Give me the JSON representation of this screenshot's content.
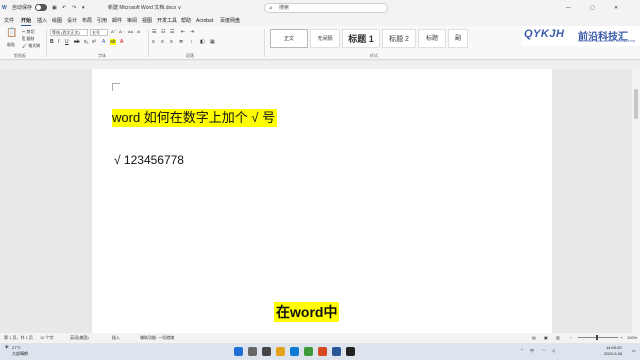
{
  "titlebar": {
    "autosave_label": "自动保存",
    "doc_title": "新建 Microsoft Word 文档.docx ∨",
    "search_placeholder": "搜索"
  },
  "menu": {
    "items": [
      "文件",
      "开始",
      "插入",
      "绘图",
      "设计",
      "布局",
      "引用",
      "邮件",
      "审阅",
      "视图",
      "开发工具",
      "帮助",
      "Acrobat",
      "百度网盘"
    ],
    "active": "开始"
  },
  "ribbon": {
    "paste_label": "粘贴",
    "cut_label": "剪切",
    "copy_label": "复制",
    "format_painter_label": "格式刷",
    "font_name": "等线 (西文正文)",
    "font_size": "五号",
    "styles": [
      "正文",
      "无间隔",
      "标题 1",
      "标题 2",
      "标题",
      "副"
    ],
    "group_labels": {
      "clipboard": "剪贴板",
      "font": "字体",
      "paragraph": "段落",
      "styles": "样式"
    }
  },
  "logo": {
    "mark": "QYKJH",
    "name": "前沿科技汇",
    "sub": "FRONTIER TECHNOLOGY COLLECTION"
  },
  "document": {
    "heading_text": "word 如何在数字上加个 √ 号",
    "number_line": "√ 123456778"
  },
  "subtitle": "在word中",
  "statusbar": {
    "page": "第 1 页，共 1 页",
    "words": "12 个字",
    "language": "英语(美国)",
    "insert_mode": "插入",
    "accessibility": "辅助功能: 一切就绪",
    "zoom": "100%"
  },
  "taskbar": {
    "weather_temp": "27°C",
    "weather_desc": "大部晴朗",
    "time": "14:09:20",
    "date": "2024-9-26"
  },
  "colors": {
    "highlight": "#ffff00",
    "accent": "#2b579a",
    "logo": "#3b5aa8"
  }
}
